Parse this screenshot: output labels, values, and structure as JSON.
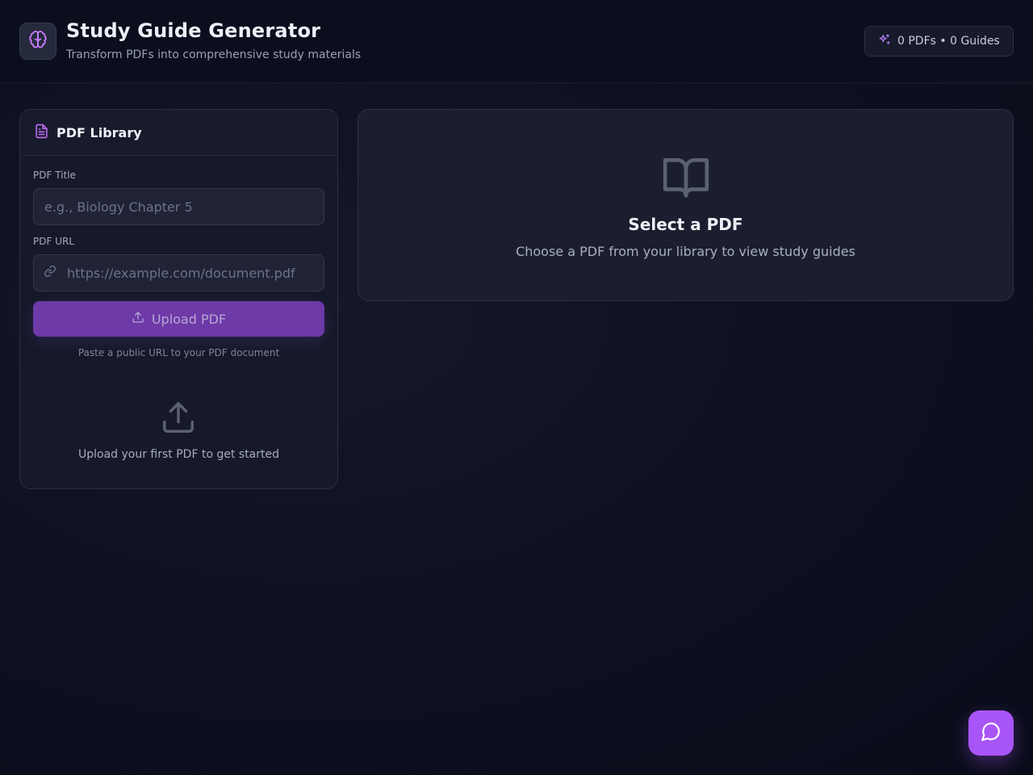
{
  "header": {
    "logo_icon": "brain-icon",
    "title": "Study Guide Generator",
    "subtitle": "Transform PDFs into comprehensive study materials",
    "stats_icon": "sparkles-icon",
    "stats": "0 PDFs • 0 Guides"
  },
  "library": {
    "icon": "file-text-icon",
    "title": "PDF Library",
    "title_label": "PDF Title",
    "title_placeholder": "e.g., Biology Chapter 5",
    "url_label": "PDF URL",
    "url_icon": "link-icon",
    "url_placeholder": "https://example.com/document.pdf",
    "upload_icon": "upload-icon",
    "upload_label": "Upload PDF",
    "hint": "Paste a public URL to your PDF document",
    "empty_icon": "upload-icon",
    "empty_text": "Upload your first PDF to get started"
  },
  "main": {
    "icon": "book-open-icon",
    "title": "Select a PDF",
    "description": "Choose a PDF from your library to view study guides"
  },
  "chat": {
    "icon": "message-circle-icon"
  },
  "colors": {
    "accent": "#a855f7",
    "button": "#6d3aa8",
    "background": "#0e1120",
    "card": "#1a1e2e"
  }
}
